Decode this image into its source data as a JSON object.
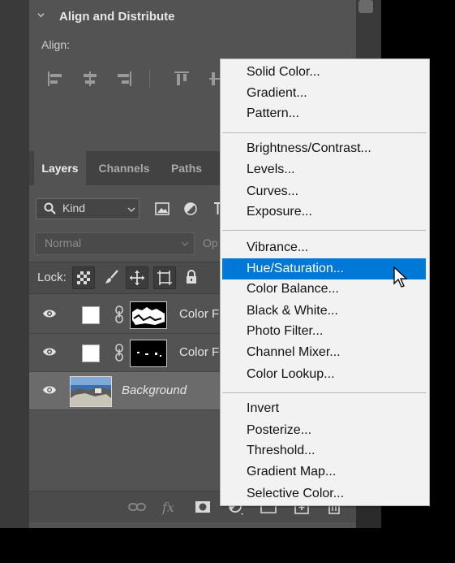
{
  "align_panel": {
    "title": "Align and Distribute",
    "align_label": "Align:"
  },
  "layers_panel": {
    "tabs": [
      "Layers",
      "Channels",
      "Paths"
    ],
    "filter_kind": "Kind",
    "blend_mode": "Normal",
    "opacity_label": "Op",
    "lock_label": "Lock:",
    "layers": [
      {
        "name": "Color Fi",
        "type": "adjustment"
      },
      {
        "name": "Color Fi",
        "type": "adjustment"
      },
      {
        "name": "Background",
        "type": "image"
      }
    ]
  },
  "menu": {
    "groups": [
      [
        "Solid Color...",
        "Gradient...",
        "Pattern..."
      ],
      [
        "Brightness/Contrast...",
        "Levels...",
        "Curves...",
        "Exposure..."
      ],
      [
        "Vibrance...",
        "Hue/Saturation...",
        "Color Balance...",
        "Black & White...",
        "Photo Filter...",
        "Channel Mixer...",
        "Color Lookup..."
      ],
      [
        "Invert",
        "Posterize...",
        "Threshold...",
        "Gradient Map...",
        "Selective Color..."
      ]
    ],
    "highlighted": "Hue/Saturation..."
  },
  "colors": {
    "panel_bg": "#535353",
    "highlight": "#0078d7",
    "menu_bg": "#f2f2f2"
  }
}
